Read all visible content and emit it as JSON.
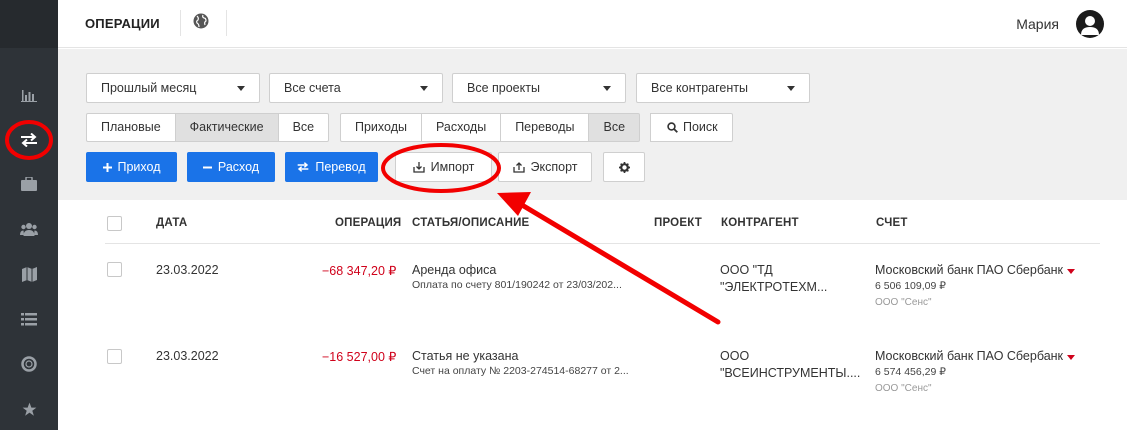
{
  "header": {
    "title": "ОПЕРАЦИИ",
    "user_name": "Мария"
  },
  "sidebar": {
    "items": [
      {
        "icon": "bar-chart-icon"
      },
      {
        "icon": "transfer-arrows-icon",
        "active": true
      },
      {
        "icon": "briefcase-icon"
      },
      {
        "icon": "users-icon"
      },
      {
        "icon": "map-icon"
      },
      {
        "icon": "list-icon"
      },
      {
        "icon": "lifebuoy-icon"
      },
      {
        "icon": "star-icon"
      }
    ]
  },
  "filters": {
    "period": "Прошлый месяц",
    "accounts": "Все счета",
    "projects": "Все проекты",
    "contractors": "Все контрагенты",
    "plan_fact": [
      "Плановые",
      "Фактические",
      "Все"
    ],
    "plan_fact_active": "Фактические",
    "op_types": [
      "Приходы",
      "Расходы",
      "Переводы",
      "Все"
    ],
    "op_types_active": "Все",
    "search": "Поиск"
  },
  "actions": {
    "income": "Приход",
    "expense": "Расход",
    "transfer": "Перевод",
    "import": "Импорт",
    "export": "Экспорт"
  },
  "table": {
    "columns": {
      "date": "ДАТА",
      "operation": "ОПЕРАЦИЯ",
      "article": "СТАТЬЯ/ОПИСАНИЕ",
      "project": "ПРОЕКТ",
      "contractor": "КОНТРАГЕНТ",
      "account": "СЧЕТ"
    },
    "rows": [
      {
        "date": "23.03.2022",
        "amount": "−68 347,20 ₽",
        "article": "Аренда офиса",
        "description": "Оплата по счету 801/190242 от 23/03/202...",
        "contractor_l1": "ООО \"ТД",
        "contractor_l2": "\"ЭЛЕКТРОТЕХМ...",
        "account": "Московский банк ПАО Сбербанк",
        "balance": "6 506 109,09 ₽",
        "company": "ООО \"Сенс\""
      },
      {
        "date": "23.03.2022",
        "amount": "−16 527,00 ₽",
        "article": "Статья не указана",
        "description": "Счет на оплату № 2203-274514-68277 от 2...",
        "contractor_l1": "ООО",
        "contractor_l2": "\"ВСЕИНСТРУМЕНТЫ....",
        "account": "Московский банк ПАО Сбербанк",
        "balance": "6 574 456,29 ₽",
        "company": "ООО \"Сенс\""
      }
    ]
  },
  "colors": {
    "accent_blue": "#1a73e8",
    "negative_red": "#d0021b",
    "annotation_red": "#f20000",
    "sidebar_bg": "#2e3338"
  }
}
